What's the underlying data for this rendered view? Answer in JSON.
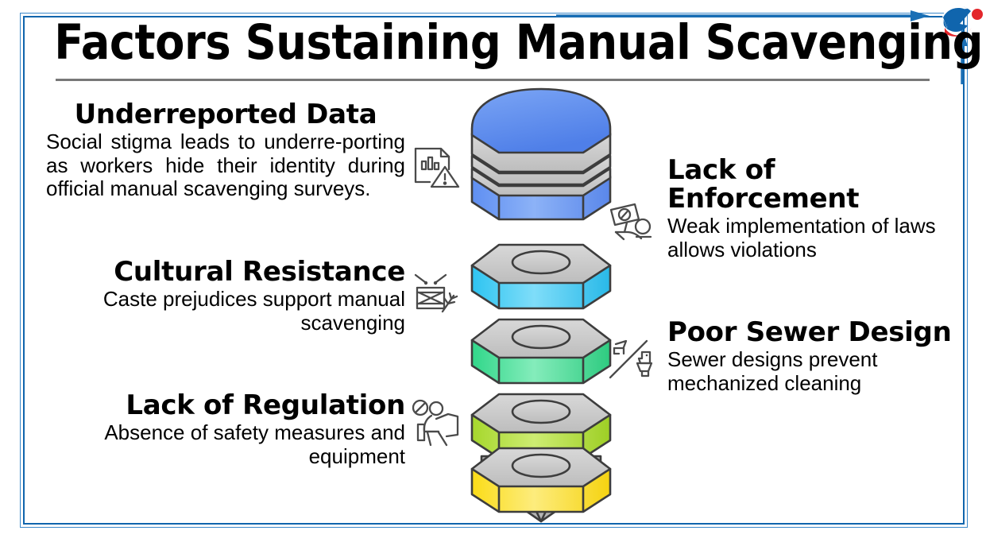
{
  "header": {
    "title": "Factors Sustaining Manual Scavenging"
  },
  "logo": {
    "name": "brand-swoosh-logo",
    "blue": "#1065ad",
    "red": "#e3262b"
  },
  "decor": {
    "frame_color_outer": "#3b88c9",
    "frame_color_inner": "#1065ad",
    "rule_color": "#787878",
    "arrow_color": "#1a6fb5"
  },
  "factors": [
    {
      "id": "underreported",
      "heading": "Underreported Data",
      "body": "Social stigma leads to underre-porting as workers hide their identity during official manual scavenging surveys.",
      "icon": "document-chart-warning-icon",
      "align": "center-justified",
      "side": "left"
    },
    {
      "id": "cultural",
      "heading": "Cultural Resistance",
      "body": "Caste prejudices support manual scavenging",
      "icon": "drum-branch-icon",
      "align": "right",
      "side": "left"
    },
    {
      "id": "regulation",
      "heading": "Lack of Regulation",
      "body": "Absence of safety measures and equipment",
      "icon": "worker-prohibited-icon",
      "align": "right",
      "side": "left"
    },
    {
      "id": "enforcement",
      "heading_line1": "Lack of",
      "heading_line2": "Enforcement",
      "body": "Weak implementation of laws allows violations",
      "icon": "protest-sign-prohibited-icon",
      "align": "left",
      "side": "right"
    },
    {
      "id": "sewer",
      "heading": "Poor Sewer Design",
      "body": "Sewer designs prevent mechanized cleaning",
      "icon": "faucet-toilet-slash-icon",
      "align": "left",
      "side": "right"
    }
  ],
  "bolt_stack": {
    "name": "bolt-nut-stack-diagram",
    "layers": [
      {
        "label": "bolt-head-blue",
        "color": "#5a8cf0",
        "color_light": "#8fb4f7"
      },
      {
        "label": "nut-cyan",
        "color": "#2ec4f1",
        "color_light": "#76dcf8"
      },
      {
        "label": "nut-green",
        "color": "#33d98c",
        "color_light": "#7ceab6"
      },
      {
        "label": "nut-yellow-green",
        "color": "#a8d82e",
        "color_light": "#c7e86e"
      },
      {
        "label": "nut-yellow",
        "color": "#fbdc18",
        "color_light": "#fdeb76"
      }
    ],
    "tip_color": "#b3b3b3",
    "cap_color": "#cccccc",
    "stroke_color": "#3d3d3d"
  }
}
